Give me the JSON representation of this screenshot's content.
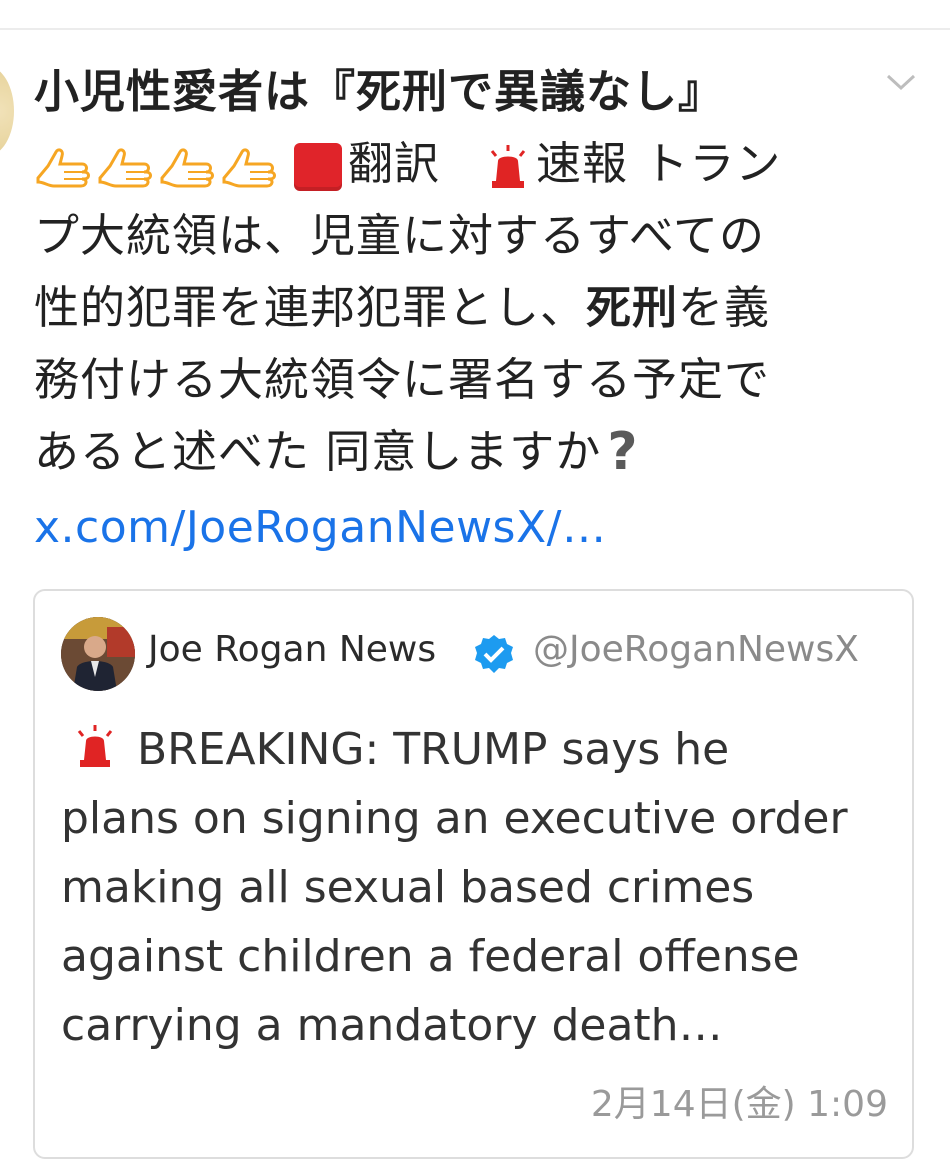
{
  "tweet": {
    "line1": "小児性愛者は『死刑で異議なし』",
    "line2_a": "翻訳",
    "line2_b": "速報 トラン",
    "line3": "プ大統領は、児童に対するすべての",
    "line4_a": "性的犯罪を連邦犯罪とし、",
    "line4_b": "死刑",
    "line4_c": "を義",
    "line5": "務付ける大統領令に署名する予定で",
    "line6": "あると述べた 同意しますか",
    "question": "?",
    "link": "x.com/JoeRoganNewsX/…"
  },
  "quote": {
    "name": "Joe Rogan News",
    "handle": "@JoeRoganNewsX",
    "body_lines": [
      "BREAKING: TRUMP says he",
      "plans on signing an executive order",
      "making all sexual based crimes",
      "against children a federal offense",
      "carrying a mandatory death…"
    ],
    "timestamp": "2月14日(金) 1:09"
  },
  "icons": {
    "thumb": "thumbs-up-icon",
    "square": "red-square-icon",
    "siren": "rotating-light-icon",
    "verified": "verified-badge-icon",
    "chevron": "chevron-down-icon"
  },
  "colors": {
    "link": "#1a73e8",
    "verified": "#1d9bf0",
    "siren": "#e02424",
    "thumb": "#f6a623"
  }
}
